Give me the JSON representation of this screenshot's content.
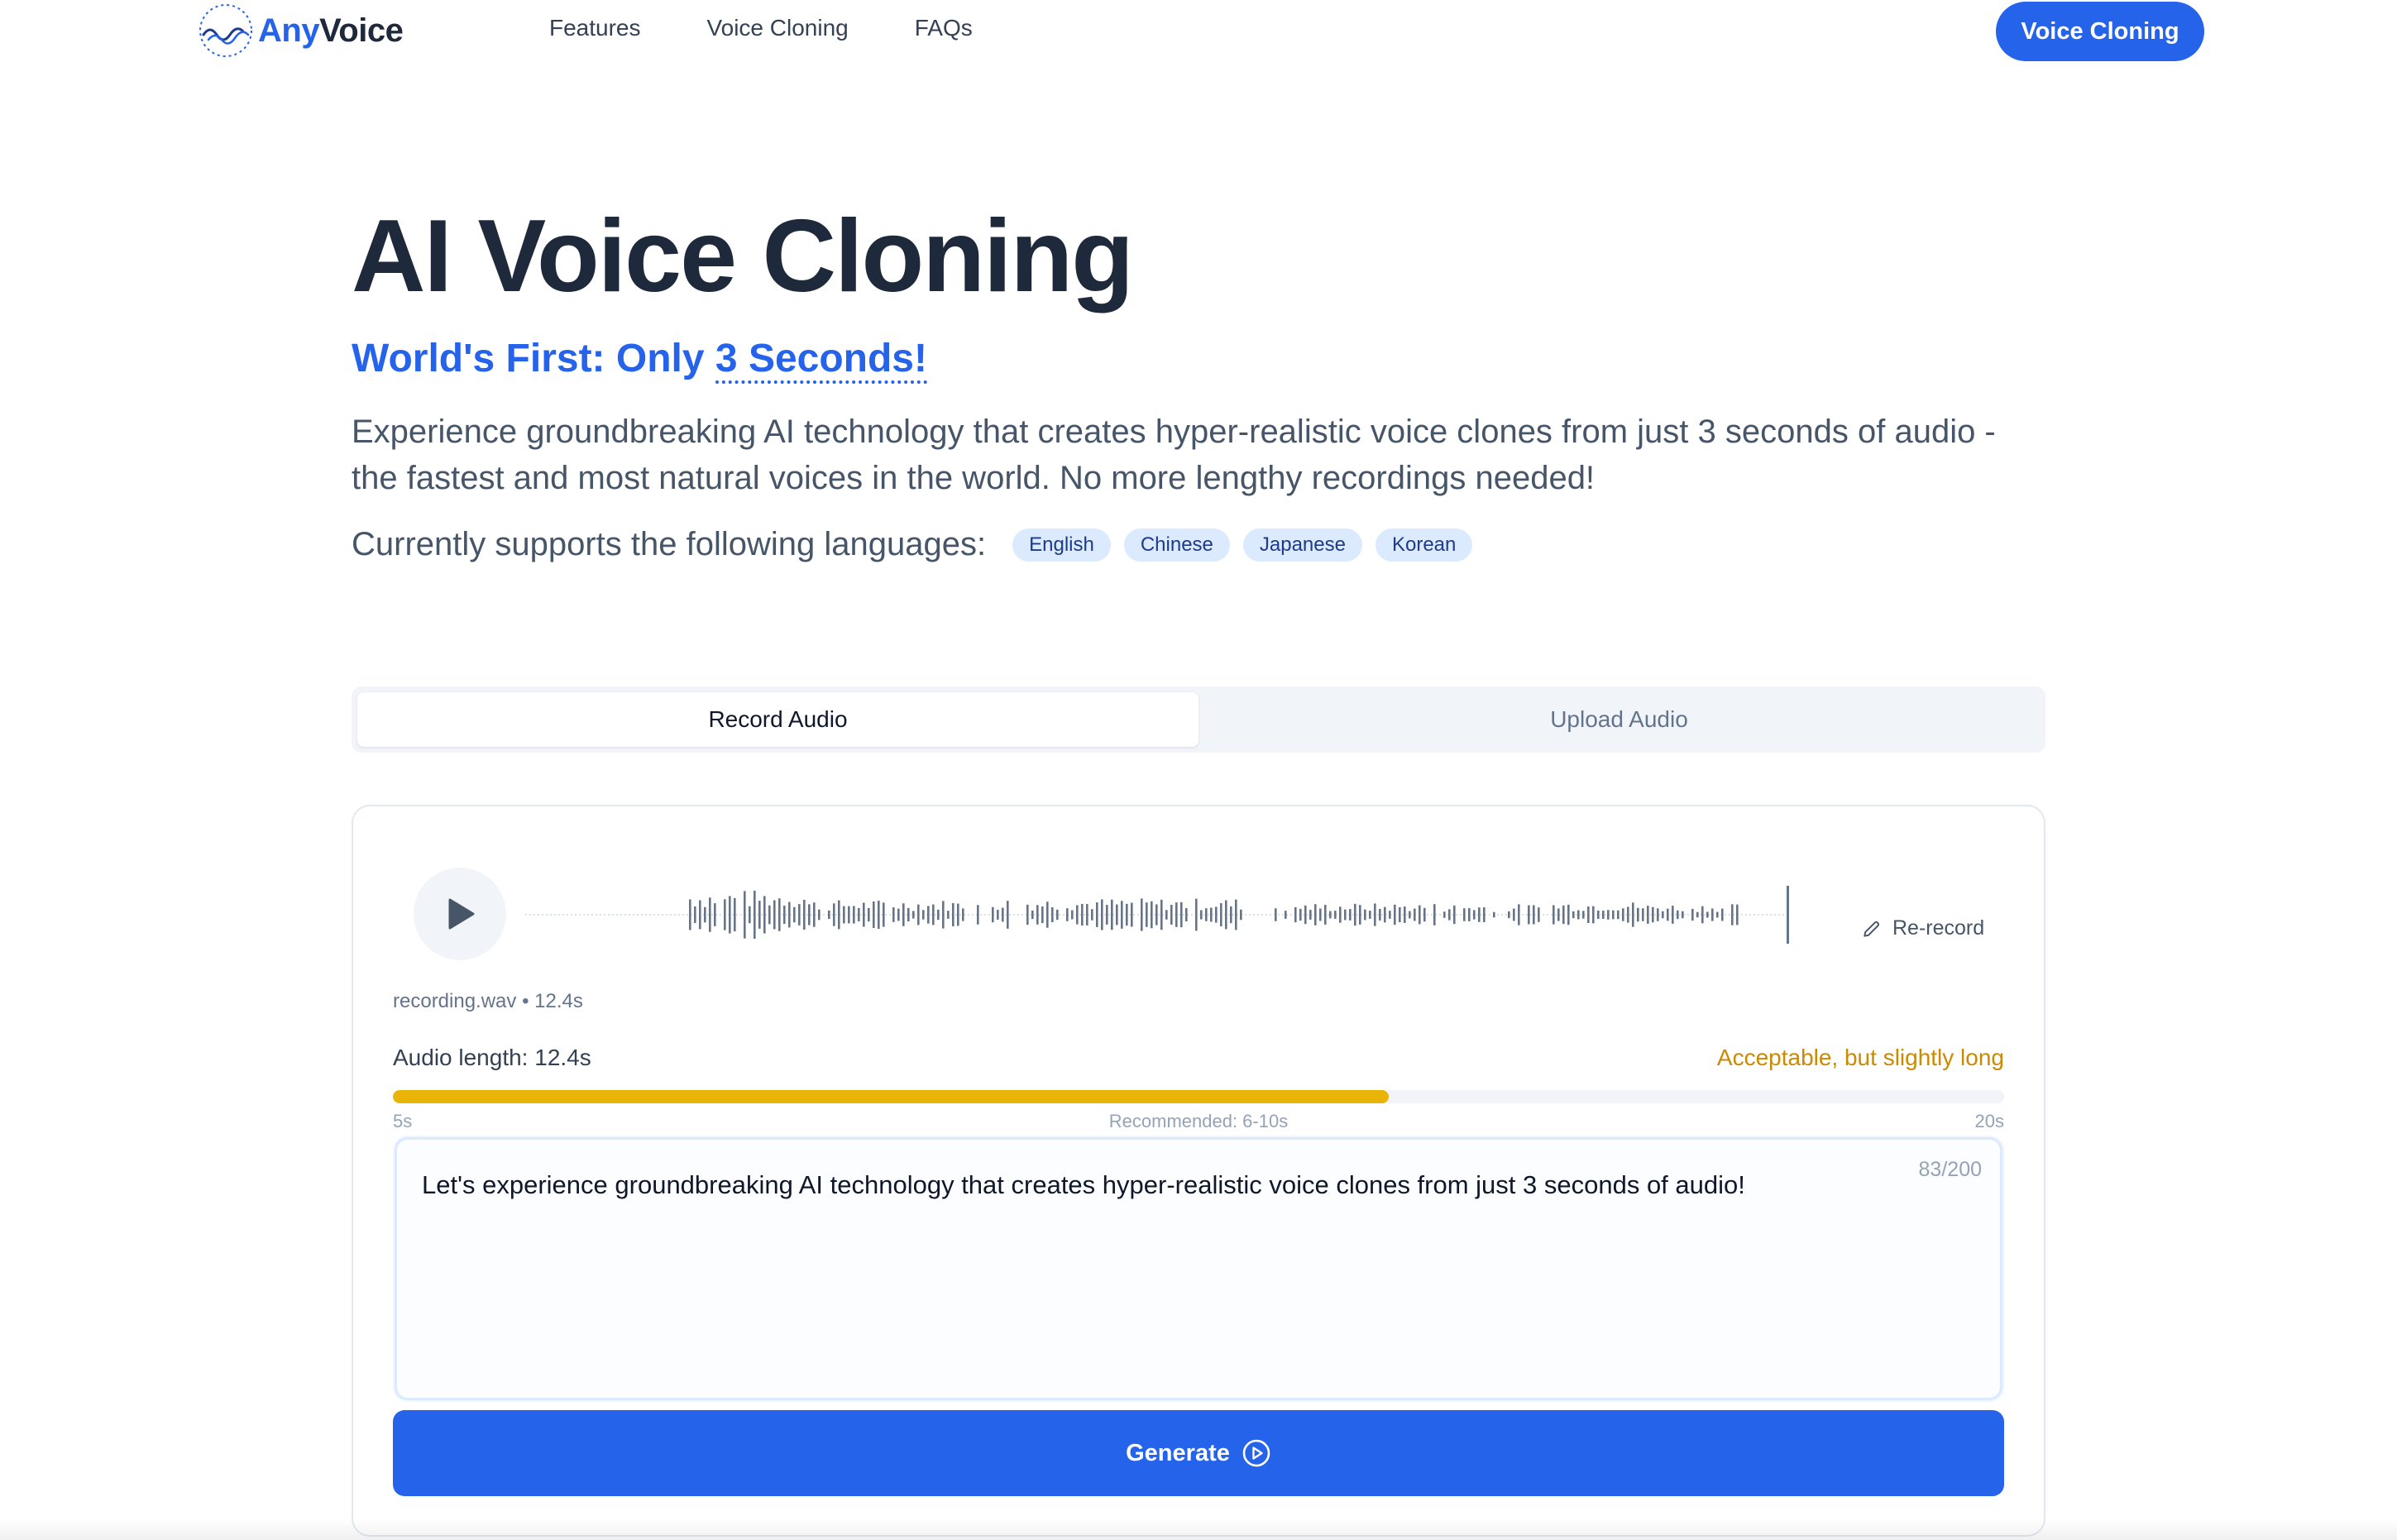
{
  "nav": {
    "logo_any": "Any",
    "logo_voice": "Voice",
    "links": [
      "Features",
      "Voice Cloning",
      "FAQs"
    ],
    "cta_label": "Voice Cloning"
  },
  "hero": {
    "title": "AI Voice Cloning",
    "subtitle_prefix": "World's First: Only ",
    "subtitle_emphasis": "3 Seconds!",
    "description": "Experience groundbreaking AI technology that creates hyper-realistic voice clones from just 3 seconds of audio - the fastest and most natural voices in the world. No more lengthy recordings needed!",
    "languages_label": "Currently supports the following languages:",
    "languages": [
      "English",
      "Chinese",
      "Japanese",
      "Korean"
    ]
  },
  "tabs": [
    {
      "label": "Record Audio",
      "active": true
    },
    {
      "label": "Upload Audio",
      "active": false
    }
  ],
  "recorder": {
    "rerecord_label": "Re-record",
    "file_info": "recording.wav • 12.4s",
    "length_label": "Audio length: 12.4s",
    "length_status": "Acceptable, but slightly long",
    "length_seconds": 12.4,
    "scale_min": "5s",
    "scale_mid": "Recommended: 6-10s",
    "scale_max": "20s",
    "progress_fraction": 0.618
  },
  "prompt": {
    "text": "Let's experience groundbreaking AI technology that creates hyper-realistic voice clones from just 3 seconds of audio!",
    "char_count": "83/200"
  },
  "actions": {
    "generate_label": "Generate"
  },
  "colors": {
    "brand": "#2563eb",
    "warning": "#ca8a04",
    "progress": "#eab308",
    "chip_bg": "#dbeafe",
    "waveform": "#64748b"
  },
  "icons": {
    "play": "play-icon",
    "rerecord": "pencil-icon",
    "generate": "play-circle-icon",
    "logo": "wave-logo-icon"
  }
}
